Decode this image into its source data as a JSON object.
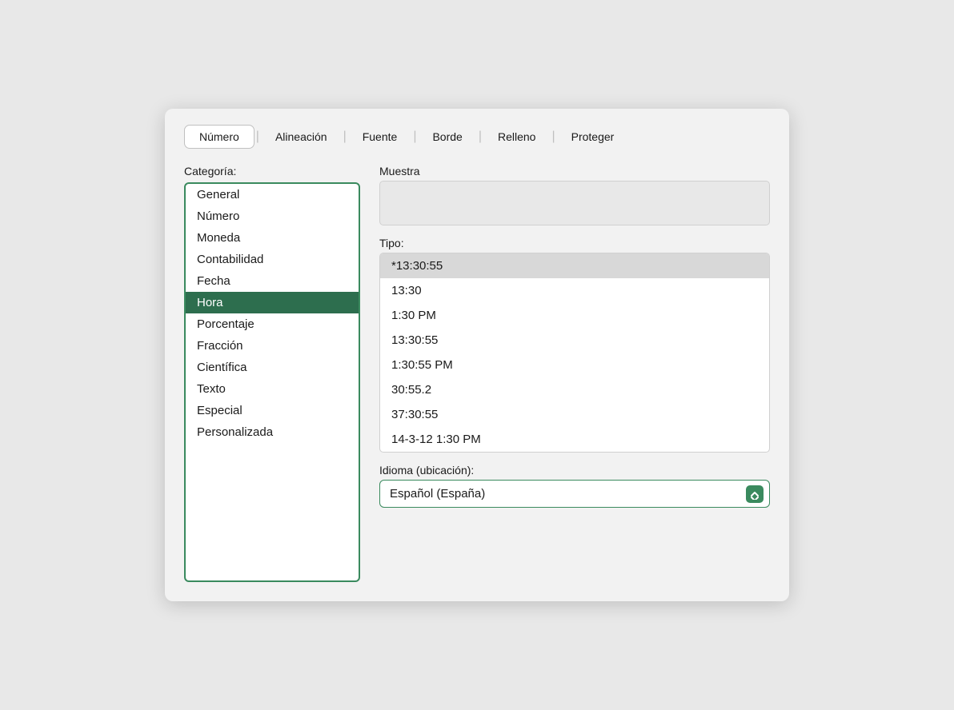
{
  "tabs": [
    {
      "label": "Número",
      "active": true
    },
    {
      "label": "Alineación",
      "active": false
    },
    {
      "label": "Fuente",
      "active": false
    },
    {
      "label": "Borde",
      "active": false
    },
    {
      "label": "Relleno",
      "active": false
    },
    {
      "label": "Proteger",
      "active": false
    }
  ],
  "category": {
    "label": "Categoría:",
    "items": [
      {
        "label": "General",
        "selected": false
      },
      {
        "label": "Número",
        "selected": false
      },
      {
        "label": "Moneda",
        "selected": false
      },
      {
        "label": "Contabilidad",
        "selected": false
      },
      {
        "label": "Fecha",
        "selected": false
      },
      {
        "label": "Hora",
        "selected": true
      },
      {
        "label": "Porcentaje",
        "selected": false
      },
      {
        "label": "Fracción",
        "selected": false
      },
      {
        "label": "Científica",
        "selected": false
      },
      {
        "label": "Texto",
        "selected": false
      },
      {
        "label": "Especial",
        "selected": false
      },
      {
        "label": "Personalizada",
        "selected": false
      }
    ]
  },
  "muestra": {
    "label": "Muestra"
  },
  "tipo": {
    "label": "Tipo:",
    "items": [
      {
        "label": "*13:30:55"
      },
      {
        "label": "13:30"
      },
      {
        "label": "1:30 PM"
      },
      {
        "label": "13:30:55"
      },
      {
        "label": "1:30:55 PM"
      },
      {
        "label": "30:55.2"
      },
      {
        "label": "37:30:55"
      },
      {
        "label": "14-3-12 1:30 PM"
      }
    ]
  },
  "idioma": {
    "label": "Idioma (ubicación):",
    "value": "Español (España)"
  }
}
